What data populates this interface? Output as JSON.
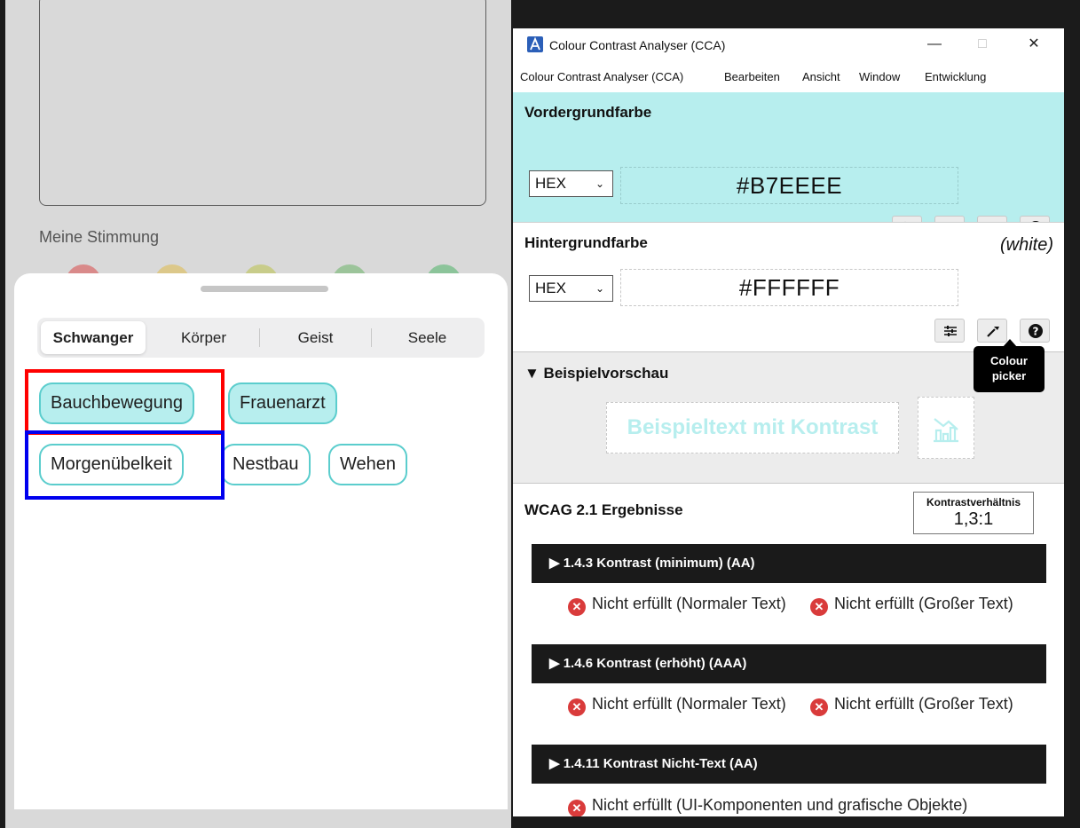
{
  "phone_app": {
    "mood_label": "Meine Stimmung",
    "tabs": [
      {
        "label": "Schwanger",
        "active": true
      },
      {
        "label": "Körper",
        "active": false
      },
      {
        "label": "Geist",
        "active": false
      },
      {
        "label": "Seele",
        "active": false
      }
    ],
    "chips": [
      {
        "label": "Bauchbewegung",
        "selected": true
      },
      {
        "label": "Frauenarzt",
        "selected": true
      },
      {
        "label": "Morgenübelkeit",
        "selected": false
      },
      {
        "label": "Nestbau",
        "selected": false
      },
      {
        "label": "Wehen",
        "selected": false
      }
    ],
    "chip_border_color": "#5BCDCD",
    "highlight_colors": {
      "red": "#FF0000",
      "blue": "#0000EE"
    }
  },
  "cca": {
    "window_title": "Colour Contrast Analyser (CCA)",
    "menu": [
      "Colour Contrast Analyser (CCA)",
      "Bearbeiten",
      "Ansicht",
      "Window",
      "Entwicklung"
    ],
    "window_controls": {
      "minimize": "—",
      "maximize": "□",
      "close": "✕"
    },
    "foreground": {
      "title": "Vordergrundfarbe",
      "format": "HEX",
      "value": "#B7EEEE",
      "tools": [
        "swap-icon",
        "sliders-icon",
        "eyedropper-icon",
        "help-icon"
      ]
    },
    "background": {
      "title": "Hintergrundfarbe",
      "name": "(white)",
      "format": "HEX",
      "value": "#FFFFFF",
      "tools": [
        "sliders-icon",
        "eyedropper-icon",
        "help-icon"
      ]
    },
    "tooltip": {
      "line1": "Colour",
      "line2": "picker"
    },
    "preview": {
      "title": "▼ Beispielvorschau",
      "sample_text": "Beispieltext mit Kontrast"
    },
    "results": {
      "title": "WCAG 2.1 Ergebnisse",
      "ratio_label": "Kontrastverhältnis",
      "ratio_value": "1,3:1",
      "criteria": [
        {
          "title": "▶ 1.4.3 Kontrast (minimum) (AA)",
          "results": [
            "Nicht erfüllt (Normaler Text)",
            "Nicht erfüllt (Großer Text)"
          ]
        },
        {
          "title": "▶ 1.4.6 Kontrast (erhöht) (AAA)",
          "results": [
            "Nicht erfüllt (Normaler Text)",
            "Nicht erfüllt (Großer Text)"
          ]
        },
        {
          "title": "▶ 1.4.11 Kontrast Nicht-Text (AA)",
          "results": [
            "Nicht erfüllt (UI-Komponenten und grafische Objekte)"
          ]
        }
      ],
      "fail_color": "#D93B3B"
    }
  }
}
